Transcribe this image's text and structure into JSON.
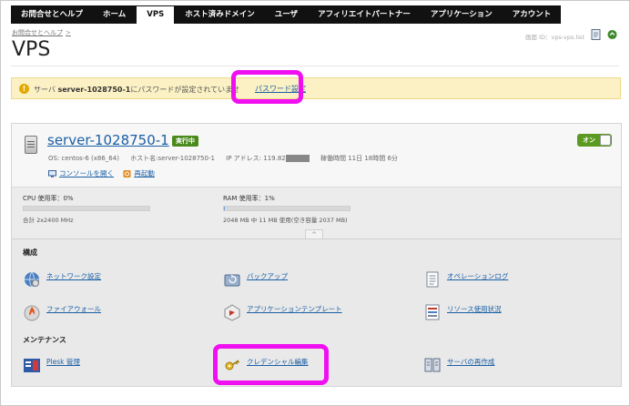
{
  "nav": {
    "tabs": [
      "お問合せとヘルプ",
      "ホーム",
      "VPS",
      "ホスト済みドメイン",
      "ユーザ",
      "アフィリエイトパートナー",
      "アプリケーション",
      "アカウント"
    ],
    "active": "VPS"
  },
  "breadcrumb": {
    "link": "お問合せとヘルプ",
    "sep": ">"
  },
  "page": {
    "title": "VPS",
    "id_label": "画面 ID：vps-vps.list"
  },
  "alert": {
    "prefix": "サーバ",
    "server": "server-1028750-1",
    "suffix": "にパスワードが設定されていませ",
    "link": "パスワード設定"
  },
  "server": {
    "name": "server-1028750-1",
    "status": "実行中",
    "toggle": "オン",
    "os": "OS: centos-6 (x86_64)",
    "host": "ホスト名:server-1028750-1",
    "ip": "IP アドレス: 119.82",
    "uptime": "稼働時間  11日  18時間  6分",
    "console": "コンソールを開く",
    "reboot": "再起動"
  },
  "resources": {
    "cpu": {
      "label": "CPU 使用率：0%",
      "sub": "合計 2x2400 MHz",
      "fill": 0
    },
    "ram": {
      "label": "RAM 使用率：1%",
      "sub": "2048 MB 中 11 MB 使用(空き容量 2037 MB)",
      "fill": 1
    }
  },
  "sections": {
    "config": "構成",
    "maintenance": "メンテナンス"
  },
  "items": {
    "network": "ネットワーク設定",
    "backup": "バックアップ",
    "oplog": "オペレーションログ",
    "firewall": "ファイアウォール",
    "apptemplate": "アプリケーションテンプレート",
    "resource": "リソース使用状況",
    "plesk": "Plesk 管理",
    "credential": "クレデンシャル編集",
    "recreate": "サーバの再作成"
  },
  "colors": {
    "highlight": "#f00ff0",
    "link": "#1a5fa6",
    "running": "#4a8a1c"
  }
}
